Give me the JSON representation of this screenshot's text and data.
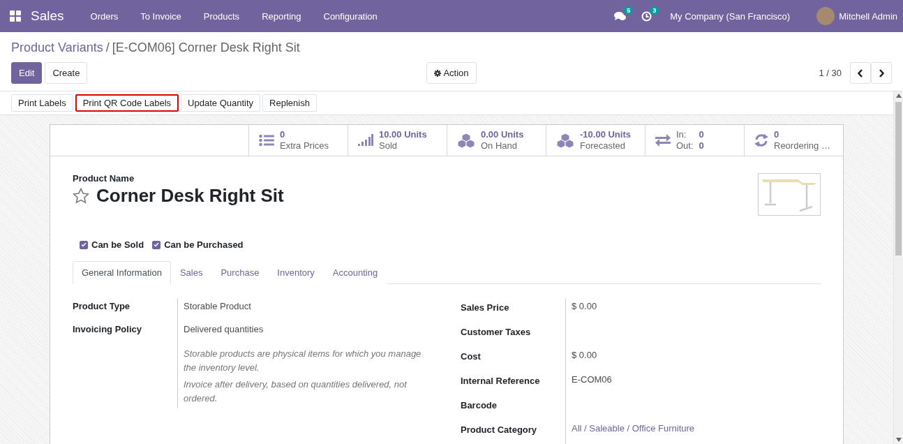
{
  "navbar": {
    "app": "Sales",
    "menu": [
      "Orders",
      "To Invoice",
      "Products",
      "Reporting",
      "Configuration"
    ],
    "messages_count": "5",
    "activities_count": "3",
    "company": "My Company (San Francisco)",
    "user": "Mitchell Admin"
  },
  "breadcrumb": {
    "parent": "Product Variants",
    "separator": "/",
    "current": "[E-COM06] Corner Desk Right Sit"
  },
  "controls": {
    "edit": "Edit",
    "create": "Create",
    "action": "Action",
    "pager": "1 / 30"
  },
  "header_buttons": [
    {
      "label": "Print Labels",
      "highlighted": false
    },
    {
      "label": "Print QR Code Labels",
      "highlighted": true
    },
    {
      "label": "Update Quantity",
      "highlighted": false
    },
    {
      "label": "Replenish",
      "highlighted": false
    }
  ],
  "stat_buttons": [
    {
      "kind": "stat",
      "value": "0",
      "label": "Extra Prices"
    },
    {
      "kind": "stat",
      "value": "10.00 Units",
      "label": "Sold"
    },
    {
      "kind": "stat",
      "value": "0.00 Units",
      "label": "On Hand"
    },
    {
      "kind": "stat",
      "value": "-10.00 Units",
      "label": "Forecasted"
    },
    {
      "kind": "inout",
      "in_label": "In:",
      "in_value": "0",
      "out_label": "Out:",
      "out_value": "0"
    },
    {
      "kind": "stat",
      "value": "0",
      "label": "Reordering …"
    }
  ],
  "product": {
    "name_label": "Product Name",
    "name": "Corner Desk Right Sit",
    "favorite": false
  },
  "checkboxes": [
    {
      "label": "Can be Sold",
      "checked": true
    },
    {
      "label": "Can be Purchased",
      "checked": true
    }
  ],
  "tabs": [
    {
      "label": "General Information",
      "selected": true
    },
    {
      "label": "Sales",
      "selected": false
    },
    {
      "label": "Purchase",
      "selected": false
    },
    {
      "label": "Inventory",
      "selected": false
    },
    {
      "label": "Accounting",
      "selected": false
    }
  ],
  "left_fields": [
    {
      "label": "Product Type",
      "value": "Storable Product"
    },
    {
      "label": "Invoicing Policy",
      "value": "Delivered quantities"
    }
  ],
  "help_notes": [
    "Storable products are physical items for which you manage the inventory level.",
    "Invoice after delivery, based on quantities delivered, not ordered."
  ],
  "right_fields": [
    {
      "label": "Sales Price",
      "kind": "text",
      "value": "$ 0.00"
    },
    {
      "label": "Customer Taxes"
    },
    {
      "label": "Cost",
      "kind": "text",
      "value": "$ 0.00"
    },
    {
      "label": "Internal Reference",
      "kind": "text",
      "value": "E-COM06"
    },
    {
      "label": "Barcode"
    },
    {
      "label": "Product Category",
      "kind": "link",
      "value": "All / Saleable / Office Furniture"
    }
  ]
}
